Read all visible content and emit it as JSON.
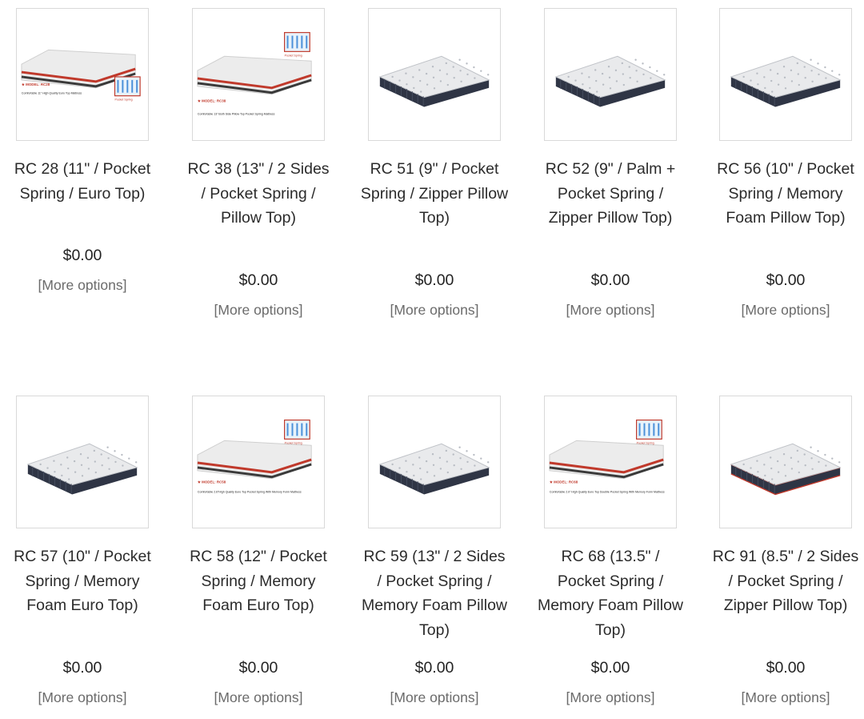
{
  "products": [
    {
      "name": "RC 28 (11\" / Pocket Spring / Euro Top)",
      "price": "$0.00",
      "more": "[More options]",
      "lines": 3,
      "image": "brochure",
      "model": "MODEL: RC28",
      "caption": "Comfortable 11\" High Quality Euro Top Mattress",
      "badge": "Pocket Spring"
    },
    {
      "name": "RC 38 (13\" / 2 Sides / Pocket Spring / Pillow Top)",
      "price": "$0.00",
      "more": "[More options]",
      "lines": 4,
      "image": "brochure",
      "model": "MODEL: RC38",
      "caption": "Comfortable 13\" Both Side Pillow Top Pocket Spring Mattress",
      "badge": "Pocket Spring"
    },
    {
      "name": "RC 51 (9\" / Pocket Spring / Zipper Pillow Top)",
      "price": "$0.00",
      "more": "[More options]",
      "lines": 4,
      "image": "plain"
    },
    {
      "name": "RC 52 (9\" / Palm + Pocket Spring / Zipper Pillow Top)",
      "price": "$0.00",
      "more": "[More options]",
      "lines": 4,
      "image": "plain"
    },
    {
      "name": "RC 56 (10\" / Pocket Spring / Memory Foam Pillow Top)",
      "price": "$0.00",
      "more": "[More options]",
      "lines": 4,
      "image": "plain"
    },
    {
      "name": "RC 57 (10\" / Pocket Spring / Memory Foam Euro Top)",
      "price": "$0.00",
      "more": "[More options]",
      "lines": 4,
      "image": "plain"
    },
    {
      "name": "RC 58 (12\" / Pocket Spring / Memory Foam Euro Top)",
      "price": "$0.00",
      "more": "[More options]",
      "lines": 4,
      "image": "brochure",
      "model": "MODEL: RC58",
      "caption": "Comfortable 2.6\"High Quality Euro Top Pocket Spring With Memory Form Mattress",
      "badge": "Pocket Spring"
    },
    {
      "name": "RC 59 (13\" / 2 Sides / Pocket Spring / Memory Foam Pillow Top)",
      "price": "$0.00",
      "more": "[More options]",
      "lines": 4,
      "image": "plain"
    },
    {
      "name": "RC 68 (13.5\" / Pocket Spring / Memory Foam Pillow Top)",
      "price": "$0.00",
      "more": "[More options]",
      "lines": 4,
      "image": "brochure",
      "model": "MODEL: RC68",
      "caption": "Comfortable 2.0\" High Quality Euro Top Doublle Pocket Spring With Memory Form Mattress",
      "badge": "Pocket Spring"
    },
    {
      "name": "RC 91 (8.5\" / 2 Sides / Pocket Spring / Zipper Pillow Top)",
      "price": "$0.00",
      "more": "[More options]",
      "lines": 4,
      "image": "plain-red"
    }
  ],
  "colors": {
    "border": "#d9d9d9",
    "text": "#2b2b2b",
    "link": "#6b6b6b",
    "accent": "#c0392b",
    "mattress_side": "#2f3545"
  }
}
